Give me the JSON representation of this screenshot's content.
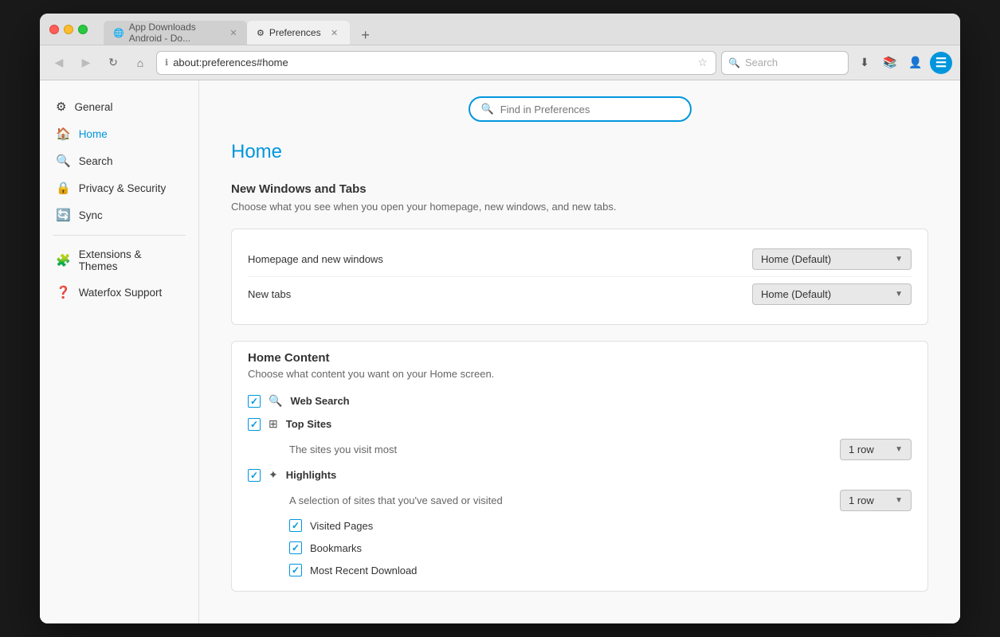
{
  "browser": {
    "tabs": [
      {
        "id": "tab1",
        "label": "App Downloads Android - Do...",
        "icon": "🌐",
        "active": false
      },
      {
        "id": "tab2",
        "label": "Preferences",
        "icon": "⚙",
        "active": true
      }
    ],
    "address": "about:preferences#home",
    "address_icon": "ℹ",
    "nav_search_placeholder": "Search",
    "new_tab_btn": "+"
  },
  "find_bar": {
    "placeholder": "Find in Preferences"
  },
  "sidebar": {
    "items": [
      {
        "id": "general",
        "label": "General",
        "icon": "⚙"
      },
      {
        "id": "home",
        "label": "Home",
        "icon": "🏠",
        "active": true
      },
      {
        "id": "search",
        "label": "Search",
        "icon": "🔍"
      },
      {
        "id": "privacy",
        "label": "Privacy & Security",
        "icon": "🔒"
      },
      {
        "id": "sync",
        "label": "Sync",
        "icon": "🔄"
      }
    ],
    "bottom_items": [
      {
        "id": "extensions",
        "label": "Extensions & Themes",
        "icon": "🧩"
      },
      {
        "id": "support",
        "label": "Waterfox Support",
        "icon": "❓"
      }
    ]
  },
  "main": {
    "title": "Home",
    "new_windows_section": {
      "heading": "New Windows and Tabs",
      "description": "Choose what you see when you open your homepage, new windows, and new tabs.",
      "homepage_label": "Homepage and new windows",
      "homepage_value": "Home (Default)",
      "newtab_label": "New tabs",
      "newtab_value": "Home (Default)"
    },
    "home_content_section": {
      "heading": "Home Content",
      "description": "Choose what content you want on your Home screen.",
      "items": [
        {
          "id": "web_search",
          "label": "Web Search",
          "icon": "🔍",
          "checked": true
        },
        {
          "id": "top_sites",
          "label": "Top Sites",
          "icon": "⊞",
          "checked": true,
          "sub_label": "The sites you visit most",
          "row_dropdown": "1 row"
        },
        {
          "id": "highlights",
          "label": "Highlights",
          "icon": "✦",
          "checked": true,
          "sub_label": "A selection of sites that you've saved or visited",
          "row_dropdown": "1 row",
          "sub_items": [
            {
              "id": "visited",
              "label": "Visited Pages",
              "checked": true
            },
            {
              "id": "bookmarks",
              "label": "Bookmarks",
              "checked": true
            },
            {
              "id": "downloads",
              "label": "Most Recent Download",
              "checked": true
            }
          ]
        }
      ]
    }
  }
}
